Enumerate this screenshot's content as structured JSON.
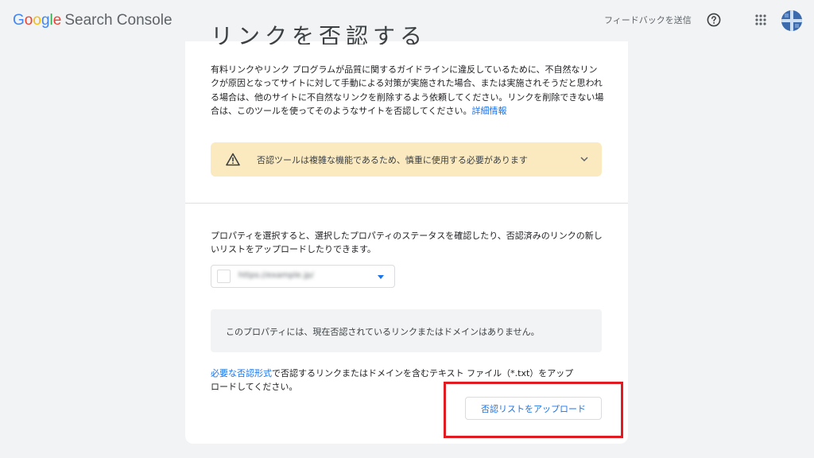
{
  "app": {
    "logo_google": "Google",
    "logo_product": "Search Console",
    "brand_colors": [
      "#4285F4",
      "#EA4335",
      "#FBBC05",
      "#4285F4",
      "#34A853",
      "#EA4335"
    ]
  },
  "header": {
    "feedback_label": "フィードバックを送信",
    "icons": [
      "help-icon",
      "apps-icon",
      "avatar"
    ]
  },
  "card": {
    "title_partial": "リンクを否認する",
    "description": "有料リンクやリンク プログラムが品質に関するガイドラインに違反しているために、不自然なリンクが原因となってサイトに対して手動による対策が実施された場合、または実施されそうだと思われる場合は、他のサイトに不自然なリンクを削除するよう依頼してください。リンクを削除できない場合は、このツールを使ってそのようなサイトを否認してください。",
    "learn_more": "詳細情報",
    "warning": {
      "text": "否認ツールは複雑な機能であるため、慎重に使用する必要があります",
      "color": "#fbeac0"
    },
    "property_description": "プロパティを選択すると、選択したプロパティのステータスを確認したり、否認済みのリンクの新しいリストをアップロードしたりできます。",
    "property_select": {
      "value": "https://example.jp/"
    },
    "empty_message": "このプロパティには、現在否認されているリンクまたはドメインはありません。",
    "format_note": {
      "link": "必要な否認形式",
      "text": "で否認するリンクまたはドメインを含むテキスト ファイル（*.txt）をアップロードしてください。"
    },
    "upload_button": "否認リストをアップロード",
    "highlight_color": "#e01b22",
    "accent_color": "#1a73e8"
  }
}
